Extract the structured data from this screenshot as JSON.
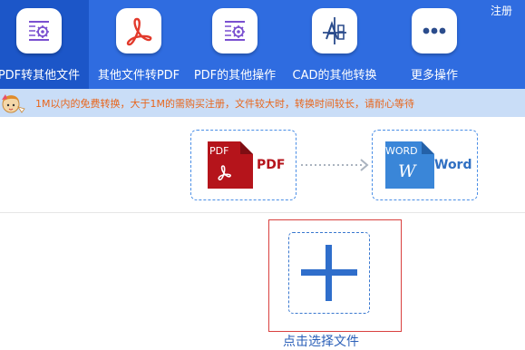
{
  "header": {
    "login_label": "注册",
    "tabs": [
      {
        "label": "PDF转其他文件",
        "icon": "gear-document-icon",
        "active": true
      },
      {
        "label": "其他文件转PDF",
        "icon": "pdf-acrobat-icon",
        "active": false
      },
      {
        "label": "PDF的其他操作",
        "icon": "gear-document-icon",
        "active": false
      },
      {
        "label": "CAD的其他转换",
        "icon": "cad-drawing-icon",
        "active": false
      },
      {
        "label": "更多操作",
        "icon": "more-dots-icon",
        "active": false
      }
    ]
  },
  "notice": {
    "text": "1M以内的免费转换，大于1M的需购买注册，文件较大时，转换时间较长，请耐心等待"
  },
  "conversion": {
    "from": {
      "badge": "PDF",
      "label": "PDF"
    },
    "to": {
      "badge": "WORD",
      "glyph": "W",
      "label": "Word"
    }
  },
  "upload": {
    "label": "点击选择文件"
  },
  "colors": {
    "header_bg": "#2f6ce0",
    "active_tab_bg": "#1c56c8",
    "notice_bg": "#c9ddf7",
    "notice_text": "#e8661c",
    "pdf_red": "#c4161c",
    "word_blue": "#3a86d8",
    "upload_border": "#d9413f"
  }
}
